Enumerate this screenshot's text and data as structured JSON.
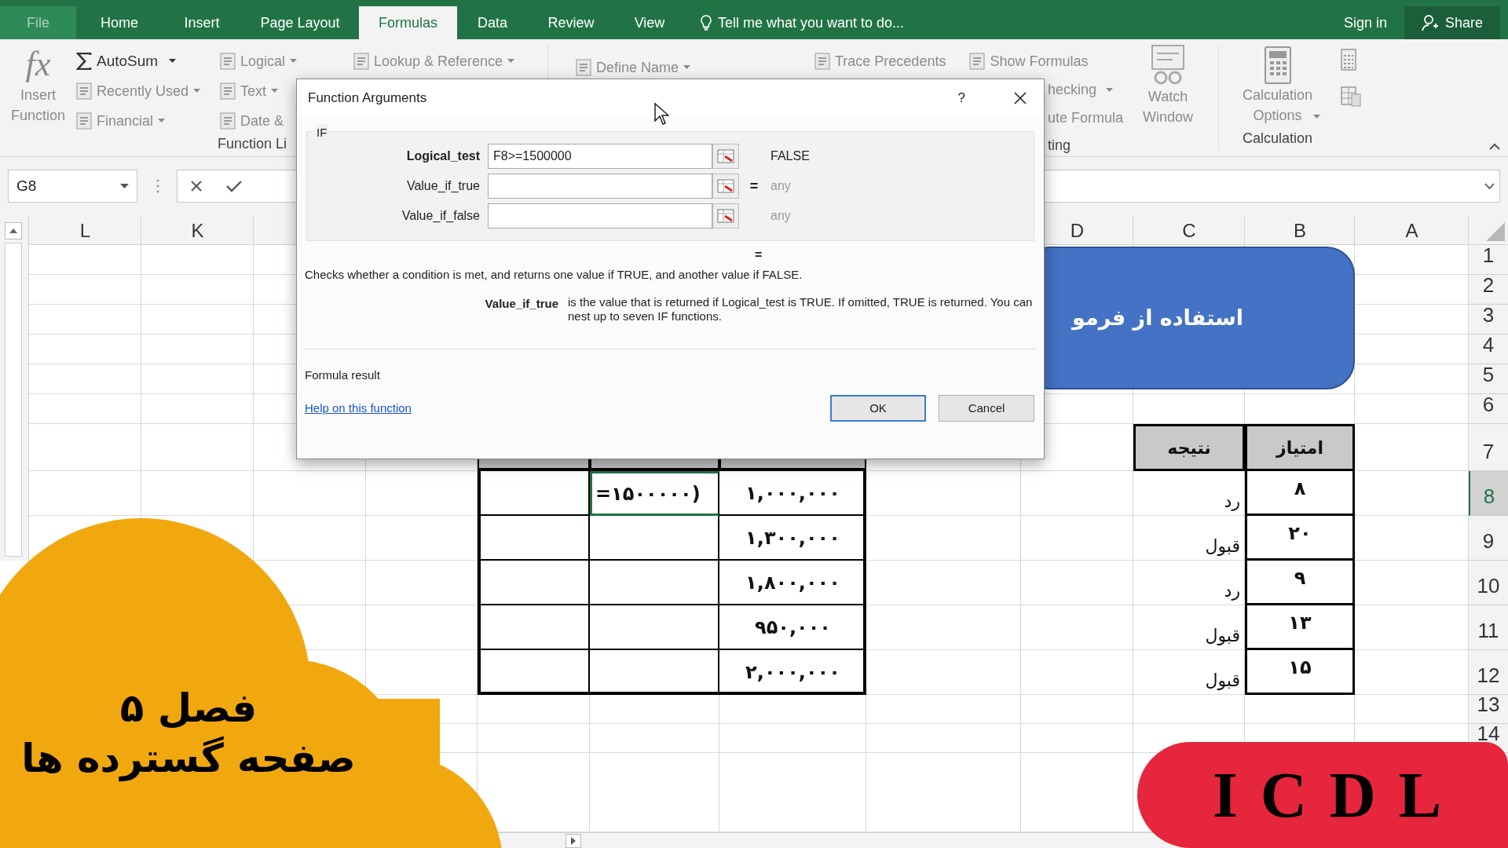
{
  "ribbon_tabs": [
    {
      "label": "File",
      "selected": false
    },
    {
      "label": "Home",
      "selected": false
    },
    {
      "label": "Insert",
      "selected": false
    },
    {
      "label": "Page Layout",
      "selected": false
    },
    {
      "label": "Formulas",
      "selected": true
    },
    {
      "label": "Data",
      "selected": false
    },
    {
      "label": "Review",
      "selected": false
    },
    {
      "label": "View",
      "selected": false
    }
  ],
  "tell_me": "Tell me what you want to do...",
  "sign_in": "Sign in",
  "share": "Share",
  "ribbon": {
    "insert_function": {
      "icon_text": "fx",
      "label": "Insert Function"
    },
    "autosum_column": [
      {
        "label": "AutoSum",
        "has_menu": true
      },
      {
        "label": "Recently Used",
        "has_menu": true
      },
      {
        "label": "Financial",
        "has_menu": true
      }
    ],
    "category_column": [
      {
        "label": "Logical",
        "has_menu": true
      },
      {
        "label": "Text",
        "has_menu": true
      },
      {
        "label": "Date &",
        "has_menu": false
      }
    ],
    "lookup": {
      "label": "Lookup & Reference",
      "has_menu": true
    },
    "function_library_label": "Function Li",
    "define_name": {
      "label": "Define Name",
      "has_menu": true
    },
    "trace_precedents": "Trace Precedents",
    "show_formulas": "Show Formulas",
    "error_checking": {
      "label": "hecking",
      "has_menu": true
    },
    "evaluate_formula": "ute Formula",
    "auditing_label": "ting",
    "watch_window": "Watch Window",
    "calculation_options": {
      "label": "Calculation Options",
      "has_menu": true
    },
    "calculation_label": "Calculation"
  },
  "name_box": "G8",
  "column_headers": [
    "L",
    "K",
    "D",
    "C",
    "B",
    "A"
  ],
  "row_headers": [
    {
      "label": "1",
      "selected": false
    },
    {
      "label": "2",
      "selected": false
    },
    {
      "label": "3",
      "selected": false
    },
    {
      "label": "4",
      "selected": false
    },
    {
      "label": "5",
      "selected": false
    },
    {
      "label": "6",
      "selected": false
    },
    {
      "label": "7",
      "selected": false
    },
    {
      "label": "8",
      "selected": true
    },
    {
      "label": "9",
      "selected": false
    },
    {
      "label": "10",
      "selected": false
    },
    {
      "label": "11",
      "selected": false
    },
    {
      "label": "12",
      "selected": false
    },
    {
      "label": "13",
      "selected": false
    },
    {
      "label": "14",
      "selected": false
    }
  ],
  "title_shape": "استفاده از فرمو",
  "score_table": {
    "headers": [
      "امتیاز",
      "نتیجه"
    ],
    "rows": [
      {
        "score": "۸",
        "result": "رد"
      },
      {
        "score": "۲۰",
        "result": "قبول"
      },
      {
        "score": "۹",
        "result": "رد"
      },
      {
        "score": "۱۳",
        "result": "قبول"
      },
      {
        "score": "۱۵",
        "result": "قبول"
      }
    ]
  },
  "amount_table": {
    "rows": [
      {
        "formula": "=۱۵۰۰۰۰۰)",
        "amount": "۱,۰۰۰,۰۰۰",
        "selected": true
      },
      {
        "amount": "۱,۳۰۰,۰۰۰",
        "selected": false
      },
      {
        "amount": "۱,۸۰۰,۰۰۰",
        "selected": false
      },
      {
        "amount": "۹۵۰,۰۰۰",
        "selected": false
      },
      {
        "amount": "۲,۰۰۰,۰۰۰",
        "selected": false
      }
    ]
  },
  "dialog": {
    "title": "Function Arguments",
    "help_mark": "?",
    "function_name": "IF",
    "arguments": [
      {
        "label": "Logical_test",
        "value": "F8>=1500000",
        "result": "FALSE",
        "active": true
      },
      {
        "label": "Value_if_true",
        "equals": "=",
        "result": "any",
        "active": false
      },
      {
        "label": "Value_if_false",
        "result": "any",
        "active": false
      }
    ],
    "result_equals": "=",
    "description": "Checks whether a condition is met, and returns one value if TRUE, and another value if FALSE.",
    "argument_name": "Value_if_true",
    "argument_help": "is the value that is returned if Logical_test is TRUE. If omitted, TRUE is returned. You can nest up to seven IF functions.",
    "formula_result": "Formula result",
    "help_link": "Help on this function",
    "buttons": [
      "OK",
      "Cancel"
    ]
  },
  "chapter_badge": {
    "line_1": "فصل ۵",
    "line_2": "صفحه گسترده ها"
  },
  "course_badge": "ICDL"
}
